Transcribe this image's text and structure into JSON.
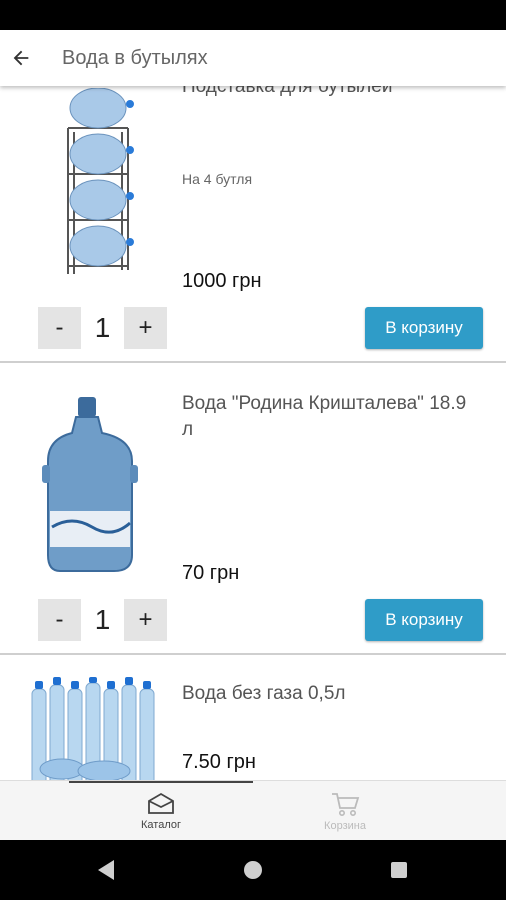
{
  "header": {
    "title": "Вода в бутылях"
  },
  "products": [
    {
      "name": "Подставка для бутылей",
      "description": "На 4 бутля",
      "price": "1000 грн",
      "qty": "1",
      "minus": "-",
      "plus": "+",
      "cart_label": "В корзину"
    },
    {
      "name": "Вода \"Родина Кришталева\" 18.9 л",
      "price": "70 грн",
      "qty": "1",
      "minus": "-",
      "plus": "+",
      "cart_label": "В корзину"
    },
    {
      "name": "Вода без газа 0,5л",
      "price": "7.50 грн"
    }
  ],
  "bottom_nav": {
    "items": [
      {
        "label": "Каталог",
        "icon": "catalog-icon",
        "active": true
      },
      {
        "label": "Корзина",
        "icon": "cart-icon",
        "active": false
      }
    ]
  },
  "colors": {
    "accent": "#2f9cc8",
    "active_nav": "#444444",
    "inactive_nav": "#bbbbbb"
  }
}
